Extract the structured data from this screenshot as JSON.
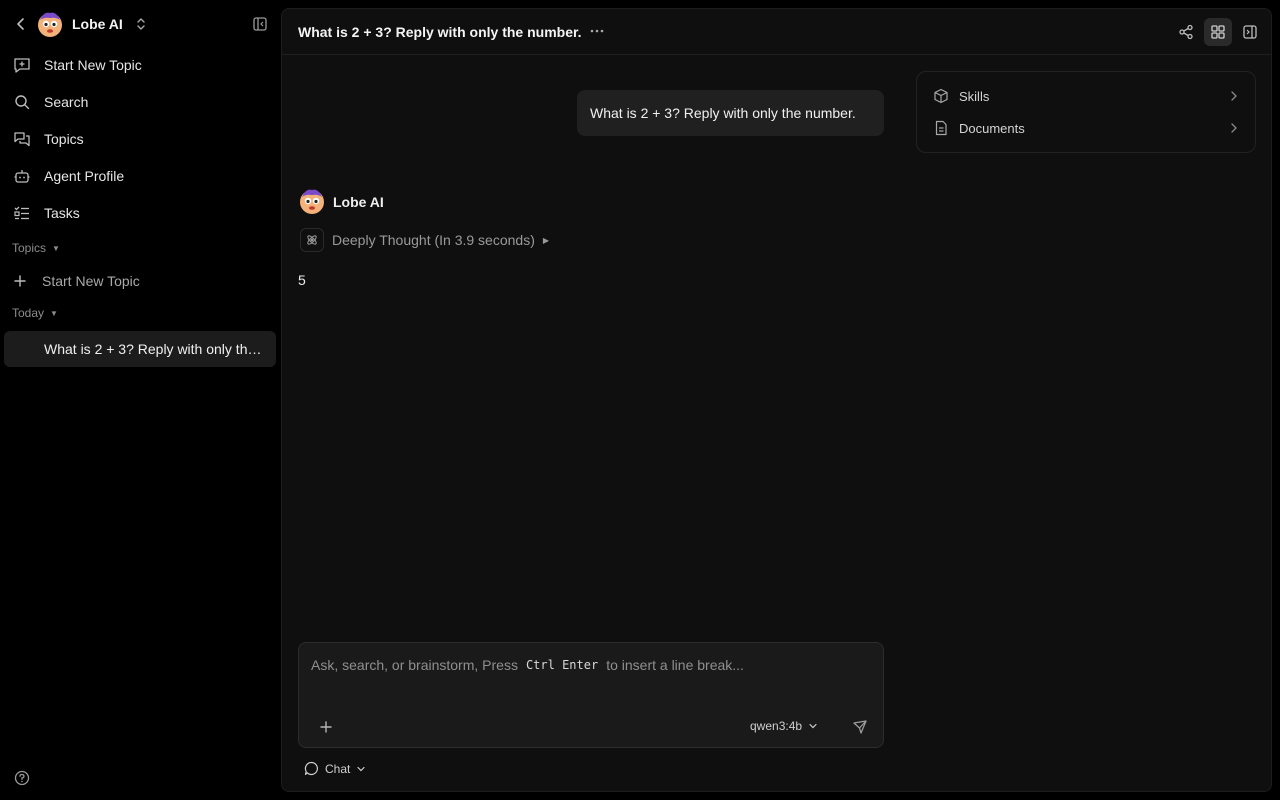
{
  "agent": {
    "name": "Lobe AI",
    "avatar_icon": "lobe-ai-avatar-icon"
  },
  "sidebar": {
    "nav": [
      {
        "label": "Start New Topic",
        "icon": "new-topic-icon"
      },
      {
        "label": "Search",
        "icon": "search-icon"
      },
      {
        "label": "Topics",
        "icon": "topics-icon"
      },
      {
        "label": "Agent Profile",
        "icon": "agent-profile-icon"
      },
      {
        "label": "Tasks",
        "icon": "tasks-icon"
      }
    ],
    "topics_section": "Topics",
    "new_topic_label": "Start New Topic",
    "today_section": "Today",
    "topics": [
      {
        "label": "What is 2 + 3? Reply with only the number."
      }
    ]
  },
  "header": {
    "title": "What is 2 + 3? Reply with only the number."
  },
  "panel": {
    "items": [
      {
        "label": "Skills",
        "icon": "skills-icon"
      },
      {
        "label": "Documents",
        "icon": "documents-icon"
      }
    ]
  },
  "conversation": {
    "user_message": "What is 2 + 3? Reply with only the number.",
    "assistant_name": "Lobe AI",
    "thought_label": "Deeply Thought (In 3.9 seconds)",
    "answer": "5"
  },
  "composer": {
    "placeholder_prefix": "Ask, search, or brainstorm, Press",
    "shortcut": "Ctrl Enter",
    "placeholder_suffix": "to insert a line break...",
    "model": "qwen3:4b"
  },
  "mode": {
    "label": "Chat"
  },
  "colors": {
    "background": "#000000",
    "surface": "#0f0f0f",
    "bubble": "#202020",
    "text": "#e8e8e8",
    "muted": "#8f8f8f"
  }
}
